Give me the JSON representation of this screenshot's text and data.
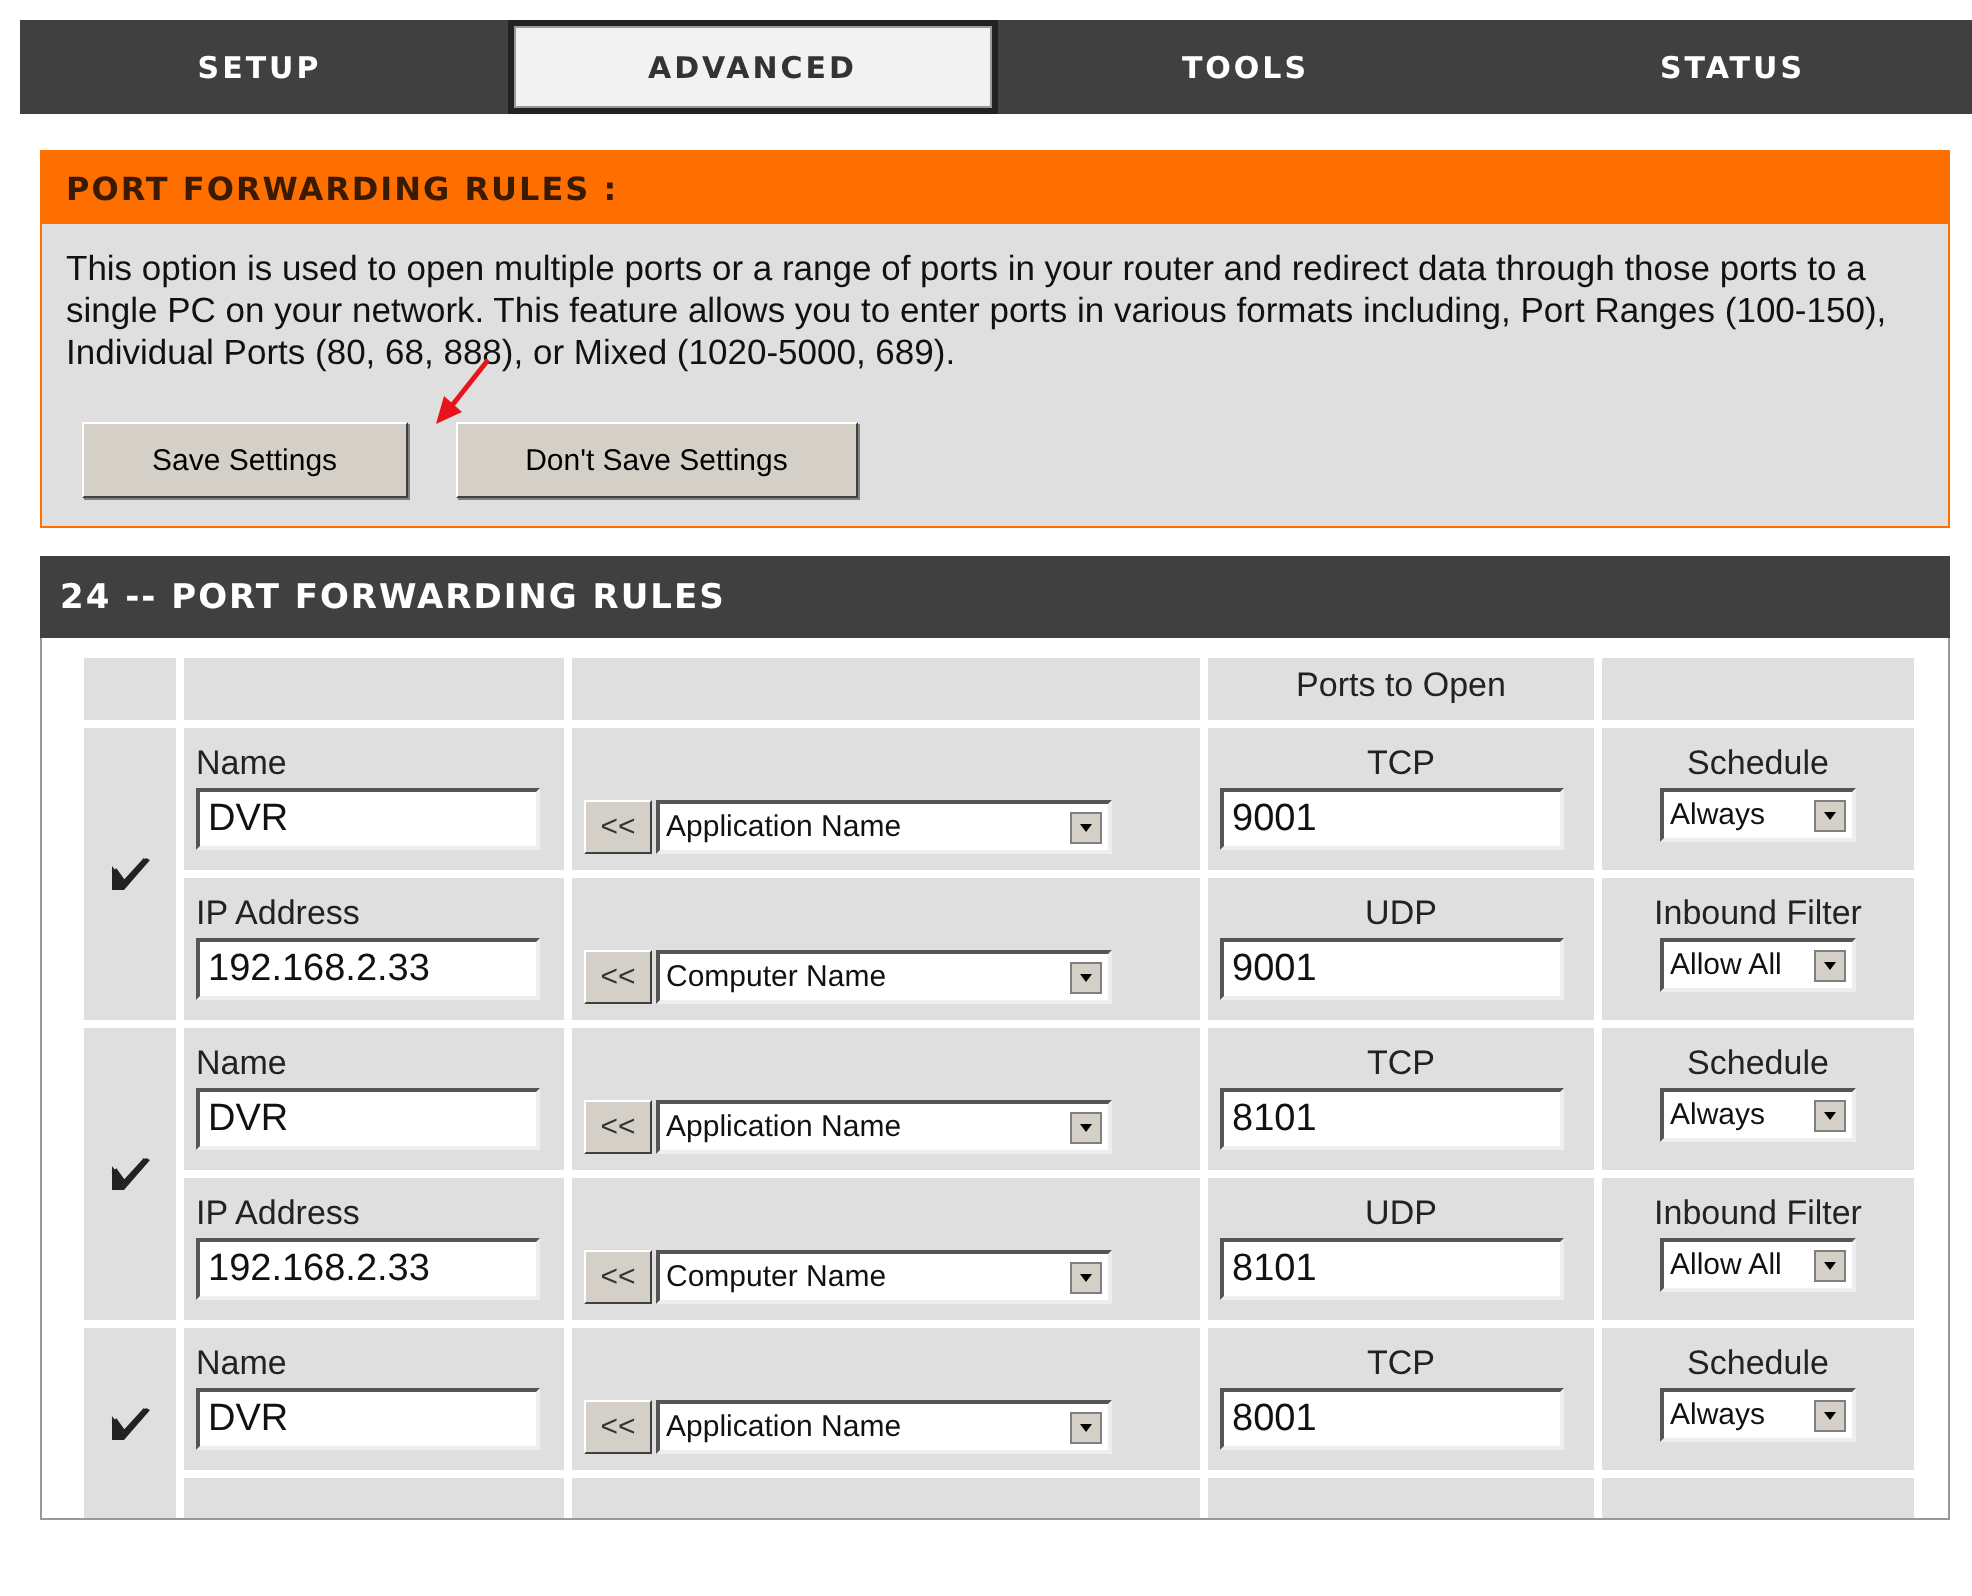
{
  "tabs": [
    {
      "label": "SETUP",
      "selected": false
    },
    {
      "label": "ADVANCED",
      "selected": true
    },
    {
      "label": "TOOLS",
      "selected": false
    },
    {
      "label": "STATUS",
      "selected": false
    }
  ],
  "intro": {
    "title": "PORT FORWARDING RULES :",
    "description": "This option is used to open multiple ports or a range of ports in your router and redirect data through those ports to a single PC on your network. This feature allows you to enter ports in various formats including, Port Ranges (100-150), Individual Ports (80, 68, 888), or Mixed (1020-5000, 689).",
    "buttons": [
      "Save Settings",
      "Don't Save Settings"
    ]
  },
  "rules_section": {
    "title": "24 -- PORT FORWARDING RULES",
    "ports_heading": "Ports to Open",
    "rules": [
      {
        "enabled": true,
        "name_label": "Name",
        "name": "DVR",
        "app_button": "<<",
        "app_select": "Application Name",
        "tcp_label": "TCP",
        "tcp": "9001",
        "schedule_label": "Schedule",
        "schedule": "Always",
        "ip_label": "IP Address",
        "ip": "192.168.2.33",
        "computer_button": "<<",
        "computer_select": "Computer Name",
        "udp_label": "UDP",
        "udp": "9001",
        "filter_label": "Inbound Filter",
        "filter": "Allow All"
      },
      {
        "enabled": true,
        "name_label": "Name",
        "name": "DVR",
        "app_button": "<<",
        "app_select": "Application Name",
        "tcp_label": "TCP",
        "tcp": "8101",
        "schedule_label": "Schedule",
        "schedule": "Always",
        "ip_label": "IP Address",
        "ip": "192.168.2.33",
        "computer_button": "<<",
        "computer_select": "Computer Name",
        "udp_label": "UDP",
        "udp": "8101",
        "filter_label": "Inbound Filter",
        "filter": "Allow All"
      },
      {
        "enabled": true,
        "name_label": "Name",
        "name": "DVR",
        "app_button": "<<",
        "app_select": "Application Name",
        "tcp_label": "TCP",
        "tcp": "8001",
        "schedule_label": "Schedule",
        "schedule": "Always"
      }
    ]
  }
}
